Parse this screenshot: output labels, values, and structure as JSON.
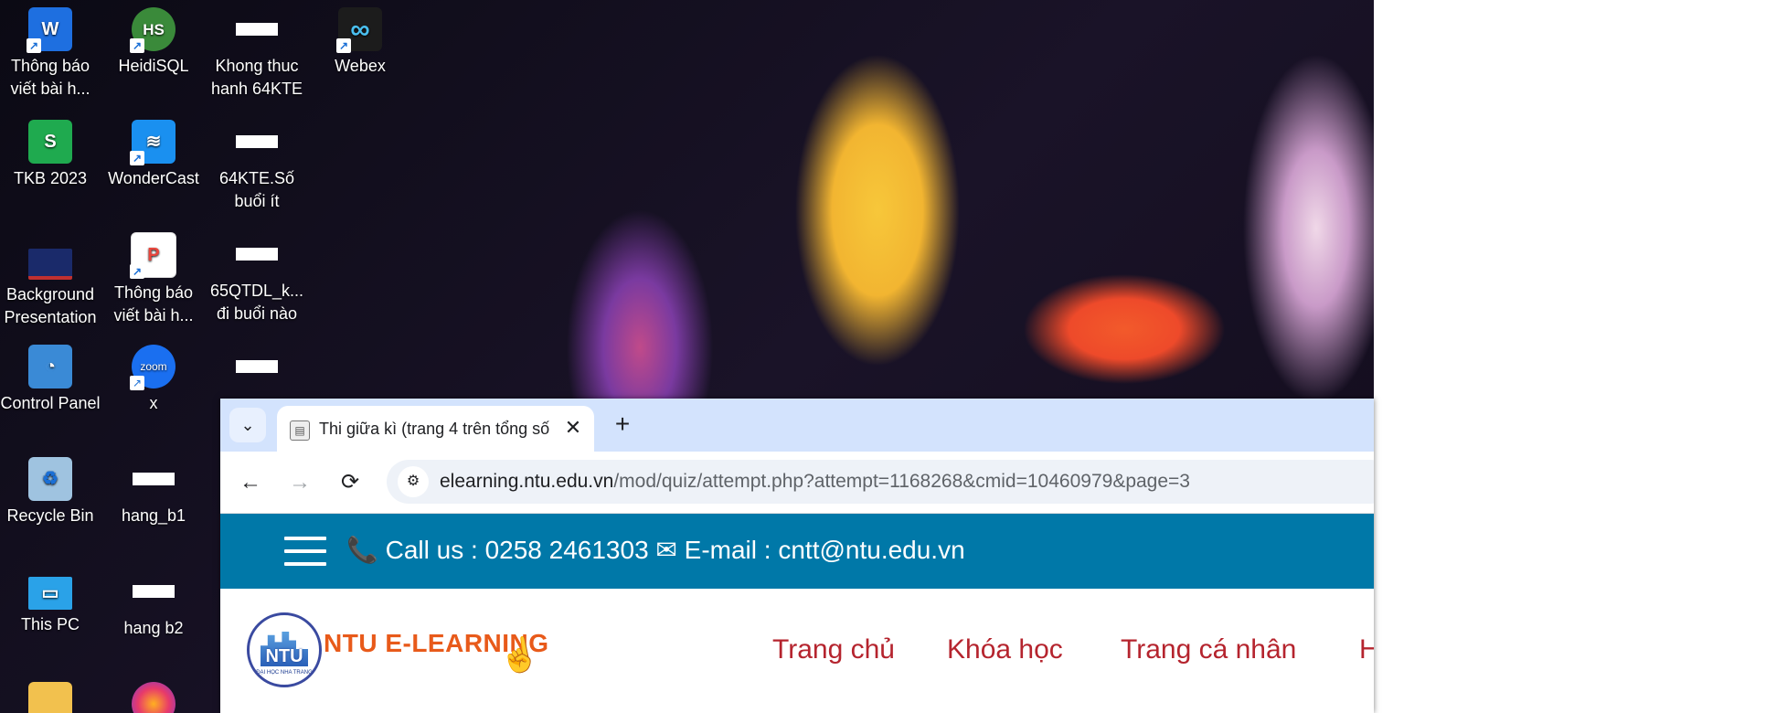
{
  "desktop": {
    "icons": [
      {
        "label": "Thông báo\nviết bài h...",
        "glyph": "W",
        "color": "#1e6fe0"
      },
      {
        "label": "TKB 2023",
        "glyph": "S",
        "color": "#1faa4f"
      },
      {
        "label": "Background\nPresentation",
        "glyph": "",
        "color": "#1a2a6a"
      },
      {
        "label": "Control Panel",
        "glyph": "◔",
        "color": "#3a8ad6"
      },
      {
        "label": "Recycle Bin",
        "glyph": "♻",
        "color": "#9fc3e0"
      },
      {
        "label": "This PC",
        "glyph": "▭",
        "color": "#2aa2e8"
      },
      {
        "label": "HeidiSQL",
        "glyph": "HS",
        "color": "#3a8a3a"
      },
      {
        "label": "WonderCast",
        "glyph": "≋",
        "color": "#1a90f0"
      },
      {
        "label": "Thông báo\nviết bài h...",
        "glyph": "P",
        "color": "#e8453c"
      },
      {
        "label": "x",
        "glyph": "zoom",
        "color": "#1a6ff0"
      },
      {
        "label": "hang_b1",
        "glyph": "",
        "color": ""
      },
      {
        "label": "hang b2",
        "glyph": "",
        "color": ""
      },
      {
        "label": "Khong thuc\nhanh 64KTE",
        "glyph": "",
        "color": ""
      },
      {
        "label": "64KTE.Số\nbuổi ít",
        "glyph": "",
        "color": ""
      },
      {
        "label": "65QTDL_k...\nđi buổi nào",
        "glyph": "",
        "color": ""
      },
      {
        "label": "Webex",
        "glyph": "∞",
        "color": "#1c1c1c"
      }
    ]
  },
  "browser": {
    "tab_list_icon": "chevron-down-icon",
    "tab_title": "Thi giữa kì (trang 4 trên tổng số",
    "tab_close": "✕",
    "new_tab": "+",
    "back": "←",
    "forward": "→",
    "reload": "⟳",
    "url_host": "elearning.ntu.edu.vn",
    "url_path": "/mod/quiz/attempt.php?attempt=1168268&cmid=10460979&page=3"
  },
  "site": {
    "contact": "📞 Call us : 0258 2461303 ✉ E-mail : cntt@ntu.edu.vn",
    "logo_text": "NTU E-LEARNING",
    "logo_ntu": "NTU",
    "logo_sub": "ĐẠI HỌC NHA TRANG",
    "menu": [
      "Trang chủ",
      "Khóa học",
      "Trang cá nhân",
      "H"
    ]
  }
}
